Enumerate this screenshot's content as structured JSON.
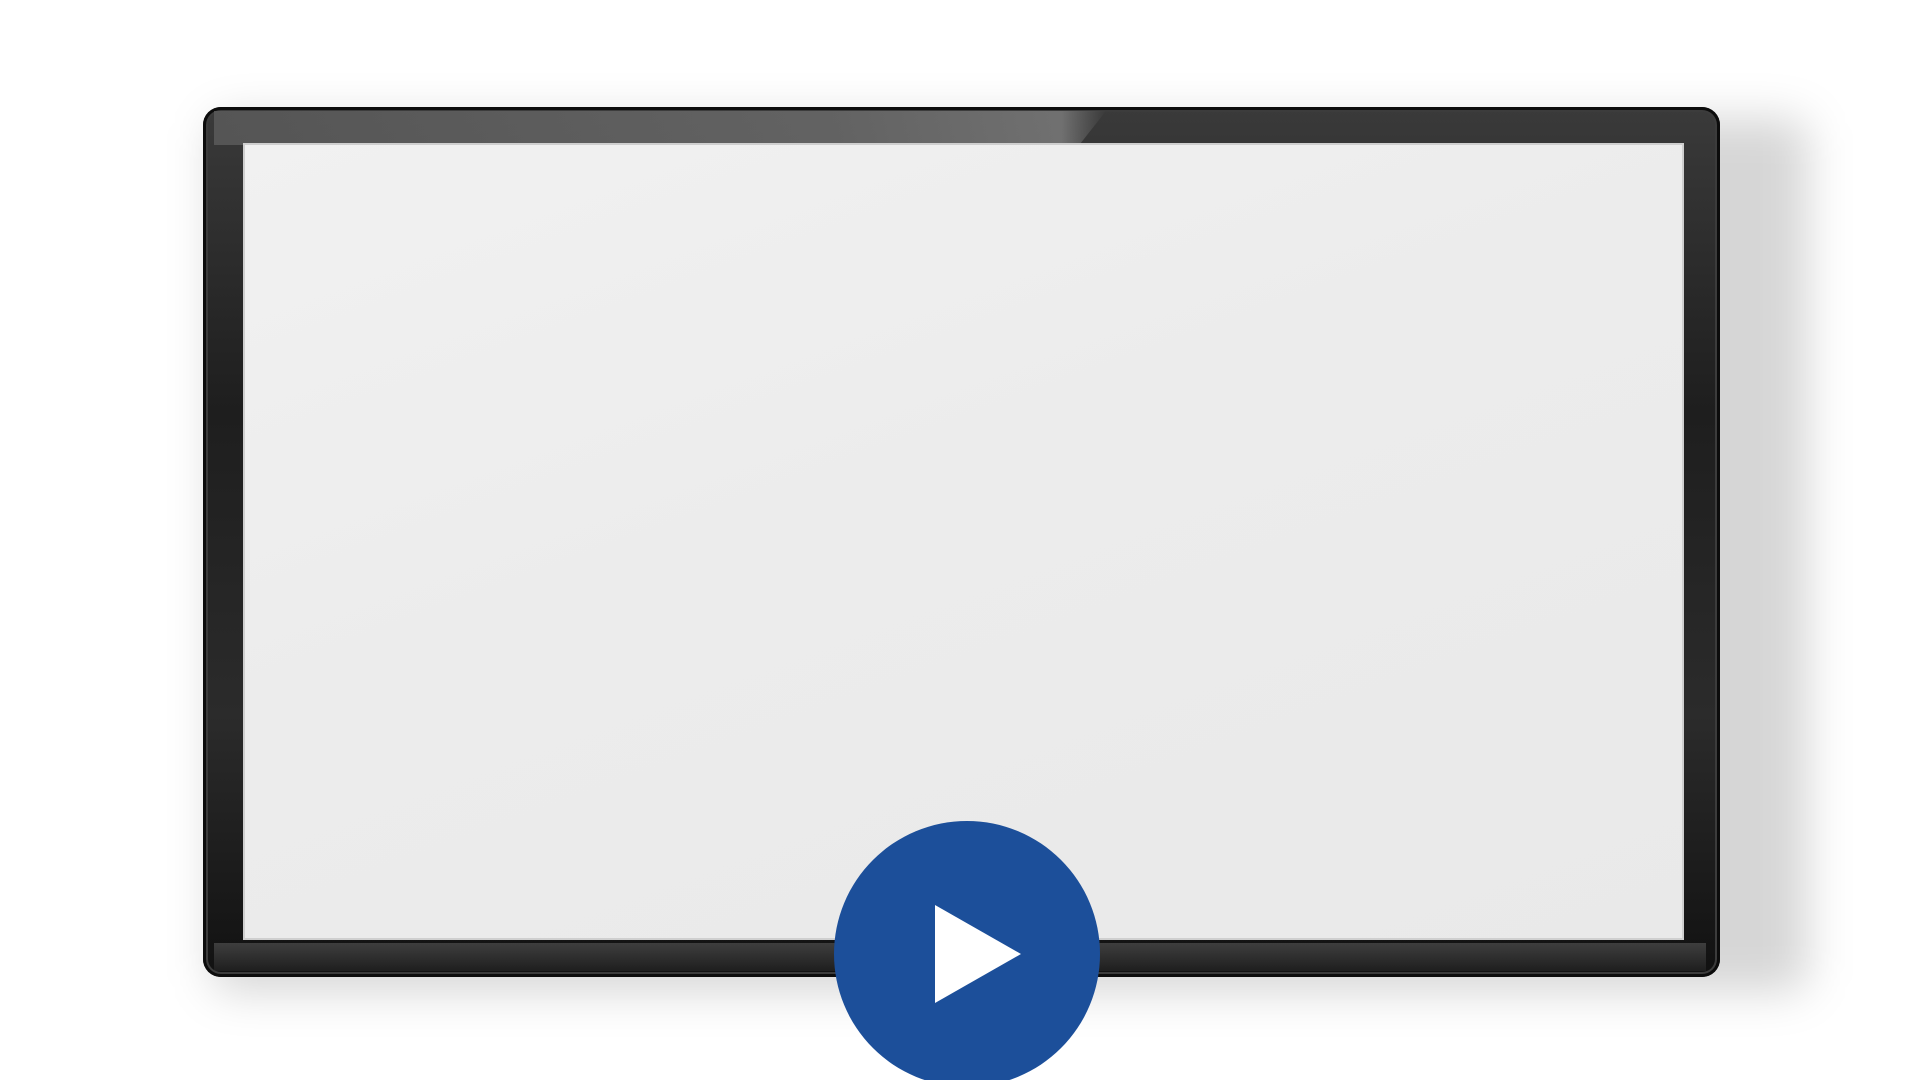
{
  "player": {
    "screen_state": "blank",
    "play_icon": "play-icon",
    "colors": {
      "frame": "#1e1e1e",
      "screen": "#ececec",
      "play_button": "#1c4f9a",
      "play_glyph": "#ffffff"
    }
  }
}
